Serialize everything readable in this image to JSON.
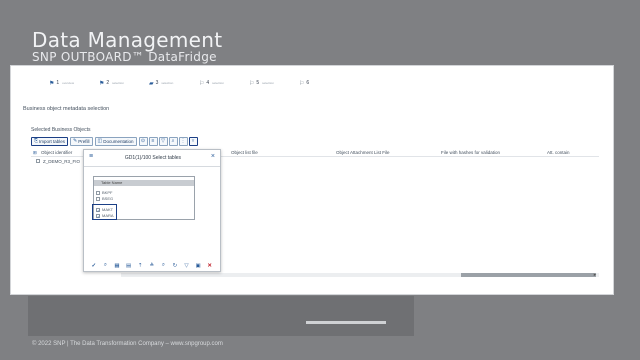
{
  "slide": {
    "title": "Data Management",
    "subtitle": "SNP OUTBOARD™ DataFridge",
    "footer": "© 2022 SNP | The Data Transformation Company – www.snpgroup.com"
  },
  "steps": [
    {
      "num": "1",
      "name": "overview"
    },
    {
      "num": "2",
      "name": "selection"
    },
    {
      "num": "3",
      "name": "selection"
    },
    {
      "num": "4",
      "name": "selection"
    },
    {
      "num": "5",
      "name": "selection"
    },
    {
      "num": "6",
      "name": ""
    }
  ],
  "section_label": "Business object metadata selection",
  "selected_label": "Selected Business Objects",
  "toolbar": {
    "import_label": "Import tables",
    "prefill_label": "Prefill",
    "documentation_label": "Documentation"
  },
  "grid": {
    "headers": [
      "Object identifier",
      "Object list file",
      "Object Attachment List File",
      "File with hashes for validation",
      "Att. contain"
    ],
    "row": {
      "identifier": "Z_DEMO_R3_FIO"
    }
  },
  "dialog": {
    "title": "GD1(1)/100 Select tables",
    "table_header": "Table Name",
    "rows": [
      {
        "name": "BKPF",
        "checked": false
      },
      {
        "name": "BSEG",
        "checked": false
      },
      {
        "name": "MAKT",
        "checked": true
      },
      {
        "name": "MARA",
        "checked": true
      }
    ]
  },
  "icons": {
    "menu": "hamburger-icon",
    "close": "close-icon",
    "ok": "checkmark-icon",
    "cancel": "cancel-icon"
  },
  "colors": {
    "accent": "#1b3f86",
    "link": "#2b5d9a",
    "cancel": "#c0202a"
  }
}
